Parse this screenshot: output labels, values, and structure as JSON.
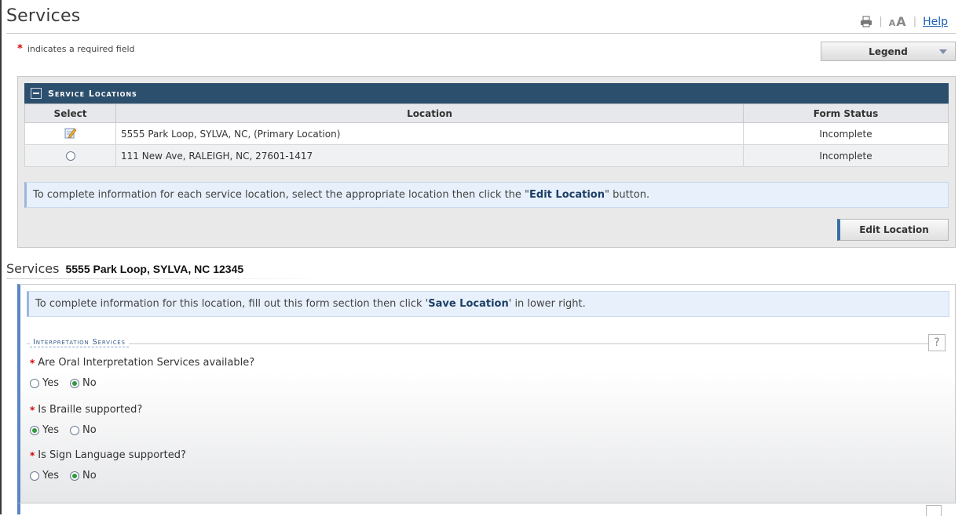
{
  "header": {
    "title": "Services",
    "font_size_small": "A",
    "font_size_big": "A",
    "help_label": "Help"
  },
  "required_note": {
    "star": "*",
    "text": "indicates a required field"
  },
  "legend_button": {
    "label": "Legend"
  },
  "service_locations": {
    "title": "Service Locations",
    "columns": [
      "Select",
      "Location",
      "Form Status"
    ],
    "rows": [
      {
        "location": "5555 Park Loop, SYLVA, NC,  (Primary Location)",
        "status": "Incomplete",
        "select": "edit-icon"
      },
      {
        "location": "111 New Ave, RALEIGH, NC, 27601-1417",
        "status": "Incomplete",
        "select": "radio-unselected"
      }
    ],
    "info_prefix": "To complete information for each service location, select the appropriate location then click the \"",
    "info_bold": "Edit Location",
    "info_suffix": "\" button.",
    "edit_button": "Edit Location"
  },
  "services": {
    "label": "Services",
    "address": "5555 Park Loop, SYLVA, NC 12345",
    "info_prefix": "To complete information for this location, fill out this form section then click '",
    "info_bold": "Save Location",
    "info_suffix": "' in lower right.",
    "fieldset_title": "Interpretation Services",
    "help_symbol": "?",
    "questions": [
      {
        "text": "Are Oral Interpretation Services available?",
        "yes_label": "Yes",
        "no_label": "No",
        "selected": "No"
      },
      {
        "text": "Is Braille supported?",
        "yes_label": "Yes",
        "no_label": "No",
        "selected": "Yes"
      },
      {
        "text": "Is Sign Language supported?",
        "yes_label": "Yes",
        "no_label": "No",
        "selected": "No"
      }
    ]
  },
  "colors": {
    "panel_header": "#2c4f6e",
    "required_star": "#d40000",
    "link": "#1a5fb4",
    "section_accent": "#5b86c5",
    "radio_checked": "#2e9b3d"
  }
}
